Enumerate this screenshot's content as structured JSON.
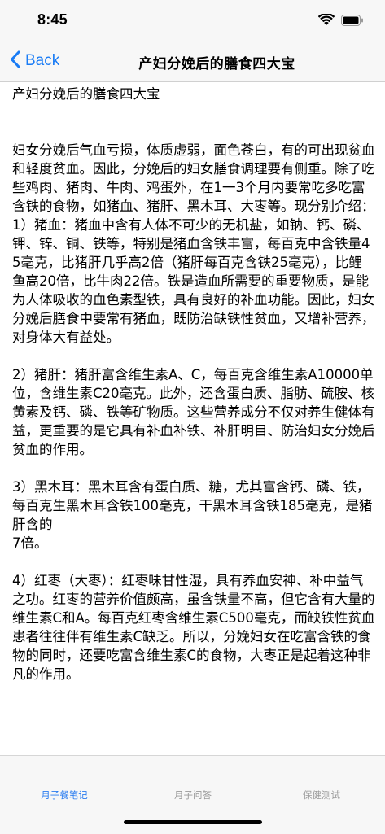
{
  "status_bar": {
    "time": "8:45"
  },
  "nav": {
    "back_label": "Back",
    "title": "产妇分娩后的膳食四大宝"
  },
  "article": {
    "text": "产妇分娩后的膳食四大宝\n\n\n妇女分娩后气血亏损，体质虚弱，面色苍白，有的可出现贫血和轻度贫血。因此，分娩后的妇女膳食调理要有侧重。除了吃些鸡肉、猪肉、牛肉、鸡蛋外，在1一3个月内要常吃多吃富含铁的食物，如猪血、猪肝、黑木耳、大枣等。现分别介绍：\n1）猪血：猪血中含有人体不可少的无机盐，如钠、钙、磷、钾、锌、铜、铁等，特别是猪血含铁丰富，每百克中含铁量45毫克，比猪肝几乎高2倍（猪肝每百克含铁25毫克），比鲤鱼高20倍，比牛肉22倍。铁是造血所需要的重要物质，是能为人体吸收的血色素型铁，具有良好的补血功能。因此，妇女分娩后膳食中要常有猪血，既防治缺铁性贫血，又增补营养，对身体大有益处。\n\n2）猪肝：猪肝富含维生素A、C，每百克含维生素A10000单位，含维生素C20毫克。此外，还含蛋白质、脂肪、硫胺、核黄素及钙、磷、铁等矿物质。这些营养成分不仅对养生健体有益，更重要的是它具有补血补铁、补肝明目、防治妇女分娩后贫血的作用。\n\n3）黑木耳：黑木耳含有蛋白质、糖，尤其富含钙、磷、铁，每百克生黑木耳含铁100毫克，干黑木耳含铁185毫克，是猪肝含的\n7倍。\n\n4）红枣（大枣）：红枣味甘性湿，具有养血安神、补中益气之功。红枣的营养价值颇高，虽含铁量不高，但它含有大量的维生素C和A。每百克红枣含维生素C500毫克，而缺铁性贫血患者往往伴有维生素C缺乏。所以，分娩妇女在吃富含铁的食物的同时，还要吃富含维生素C的食物，大枣正是起着这种非凡的作用。"
  },
  "tabs": [
    {
      "label": "月子餐笔记",
      "active": true
    },
    {
      "label": "月子问答",
      "active": false
    },
    {
      "label": "保健测试",
      "active": false
    }
  ],
  "colors": {
    "accent": "#1a7cf5",
    "tab_inactive": "#9a9a9a",
    "bar_bg": "#f7f7f7"
  }
}
